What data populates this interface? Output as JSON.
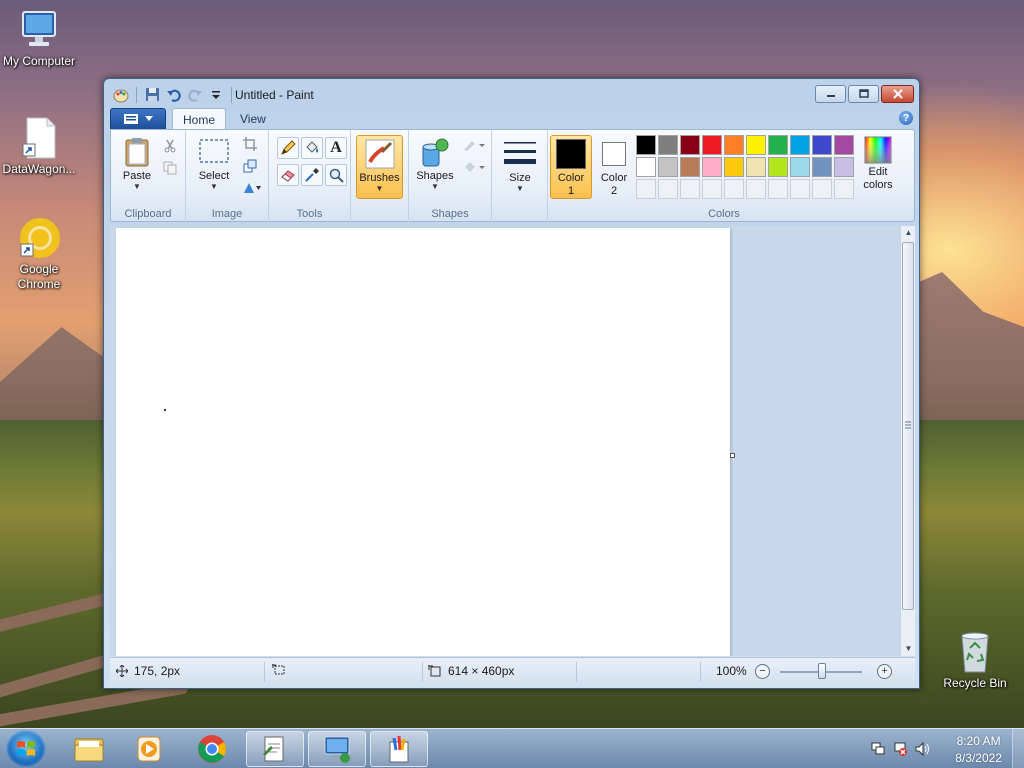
{
  "desktop": {
    "icons": [
      {
        "label": "My Computer"
      },
      {
        "label": "DataWagon..."
      },
      {
        "label": "Google Chrome"
      },
      {
        "label": "Recycle Bin"
      }
    ]
  },
  "window": {
    "title": "Untitled - Paint",
    "tabs": {
      "home": "Home",
      "view": "View"
    },
    "help_icon": "?"
  },
  "ribbon": {
    "clipboard": {
      "label": "Clipboard",
      "paste": "Paste"
    },
    "image": {
      "label": "Image",
      "select": "Select"
    },
    "tools": {
      "label": "Tools",
      "text_glyph": "A"
    },
    "brushes": "Brushes",
    "shapes": {
      "label": "Shapes",
      "button": "Shapes"
    },
    "size": "Size",
    "colors": {
      "label": "Colors",
      "color1": "Color\n1",
      "color2": "Color\n2",
      "color1_value": "#000000",
      "color2_value": "#ffffff",
      "edit": "Edit\ncolors",
      "palette_row1": [
        "#000000",
        "#7f7f7f",
        "#880015",
        "#ed1c24",
        "#ff7f27",
        "#fff200",
        "#22b14c",
        "#00a2e8",
        "#3f48cc",
        "#a349a4"
      ],
      "palette_row2": [
        "#ffffff",
        "#c3c3c3",
        "#b97a57",
        "#ffaec9",
        "#ffc90e",
        "#efe4b0",
        "#b5e61d",
        "#99d9ea",
        "#7092be",
        "#c8bfe7"
      ]
    }
  },
  "status": {
    "cursor_pos": "175, 2px",
    "canvas_size": "614 × 460px",
    "zoom": "100%"
  },
  "taskbar": {
    "time": "8:20 AM",
    "date": "8/3/2022"
  }
}
